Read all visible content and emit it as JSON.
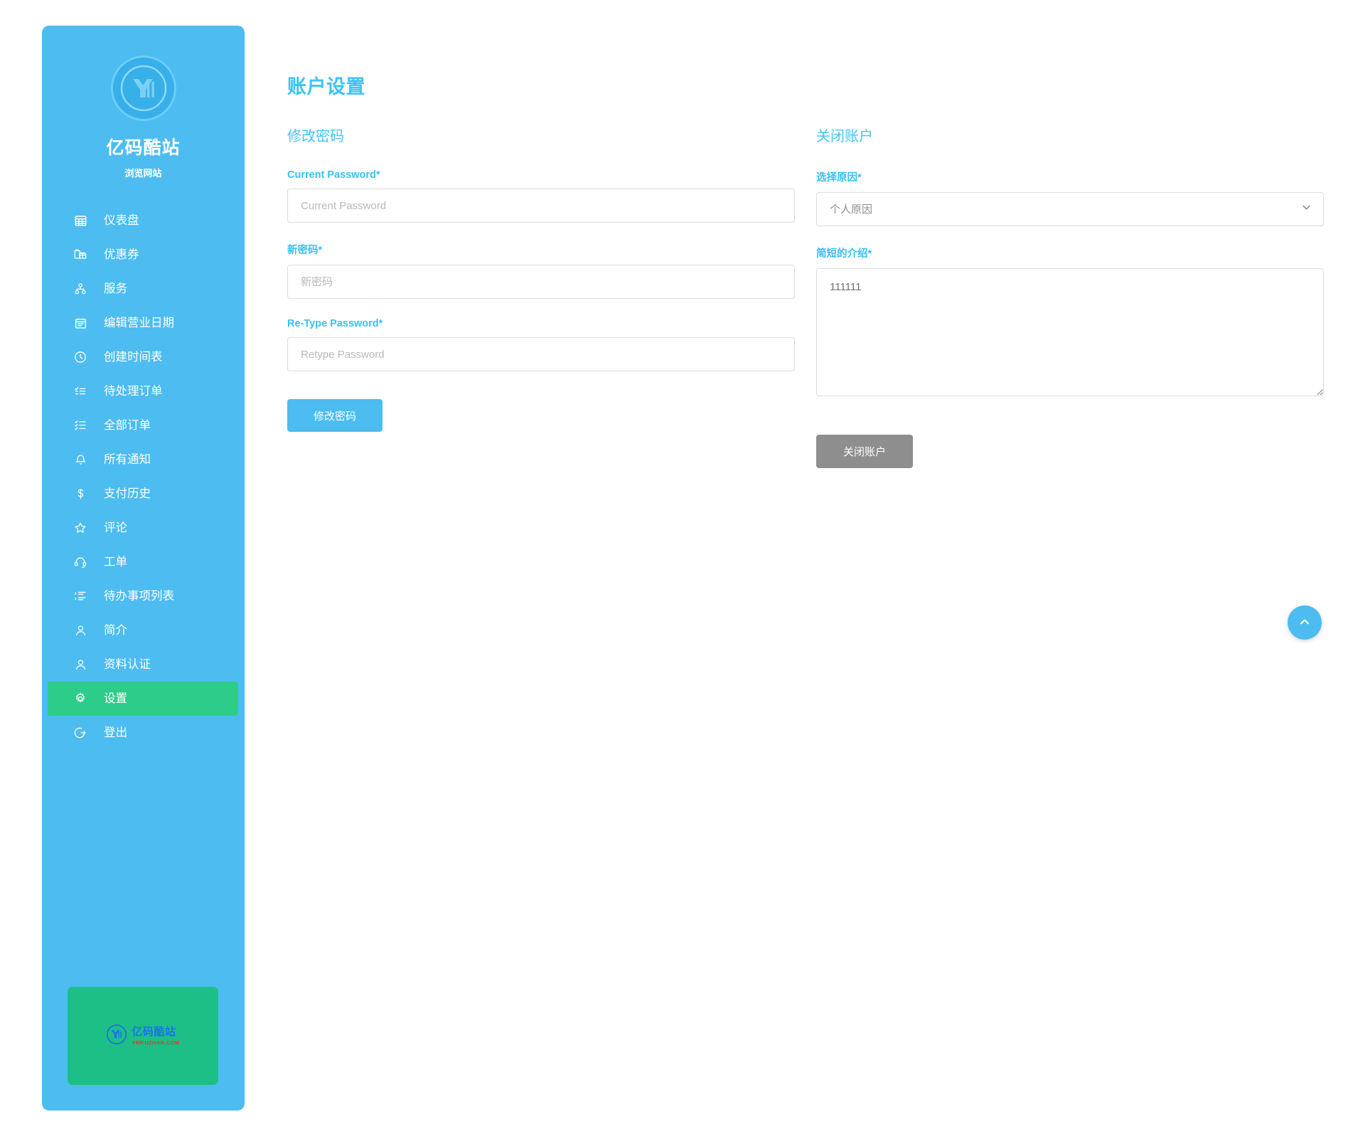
{
  "brand": {
    "name": "亿码酷站",
    "subtitle": "浏览网站",
    "logo_icon": "ym-circle-logo"
  },
  "sidebar": {
    "items": [
      {
        "label": "仪表盘",
        "icon": "grid-dashboard-icon",
        "active": false
      },
      {
        "label": "优惠券",
        "icon": "gift-coupon-icon",
        "active": false
      },
      {
        "label": "服务",
        "icon": "sitemap-service-icon",
        "active": false
      },
      {
        "label": "编辑营业日期",
        "icon": "calendar-icon",
        "active": false
      },
      {
        "label": "创建时间表",
        "icon": "clock-icon",
        "active": false
      },
      {
        "label": "待处理订单",
        "icon": "list-check-icon",
        "active": false
      },
      {
        "label": "全部订单",
        "icon": "list-ordered-icon",
        "active": false
      },
      {
        "label": "所有通知",
        "icon": "bell-icon",
        "active": false
      },
      {
        "label": "支付历史",
        "icon": "dollar-icon",
        "active": false
      },
      {
        "label": "评论",
        "icon": "star-icon",
        "active": false
      },
      {
        "label": "工单",
        "icon": "headset-icon",
        "active": false
      },
      {
        "label": "待办事项列表",
        "icon": "tasks-list-icon",
        "active": false
      },
      {
        "label": "简介",
        "icon": "user-icon",
        "active": false
      },
      {
        "label": "资料认证",
        "icon": "user-check-icon",
        "active": false
      },
      {
        "label": "设置",
        "icon": "gear-icon",
        "active": true
      },
      {
        "label": "登出",
        "icon": "logout-icon",
        "active": false
      }
    ],
    "promo": {
      "logo_icon": "ym-circle-logo",
      "title": "亿码酷站",
      "url": "YMKUZHAN.COM"
    }
  },
  "main": {
    "page_title": "账户设置",
    "change_password": {
      "section_title": "修改密码",
      "current_password": {
        "label": "Current Password*",
        "placeholder": "Current Password",
        "value": ""
      },
      "new_password": {
        "label": "新密码*",
        "placeholder": "新密码",
        "value": ""
      },
      "retype_password": {
        "label": "Re-Type Password*",
        "placeholder": "Retype Password",
        "value": ""
      },
      "submit_label": "修改密码"
    },
    "close_account": {
      "section_title": "关闭账户",
      "reason": {
        "label": "选择原因*",
        "selected": "个人原因",
        "chevron_icon": "chevron-down-icon"
      },
      "description": {
        "label": "简短的介绍*",
        "value": "111111",
        "placeholder": ""
      },
      "submit_label": "关闭账户"
    },
    "scroll_top_icon": "chevron-up-icon"
  },
  "colors": {
    "sidebar_blue": "#4dbcf0",
    "accent_cyan": "#3ec2f3",
    "active_green": "#2ecc8b",
    "promo_green": "#1dbf87",
    "secondary_gray": "#8e8e8e",
    "border_gray": "#dcdcdc"
  }
}
